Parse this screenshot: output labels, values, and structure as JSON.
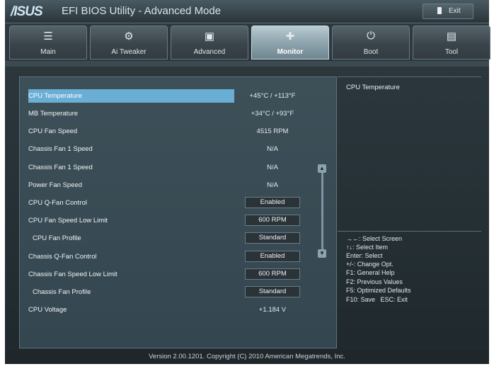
{
  "titlebar": {
    "logo": "/ISUS",
    "title": "EFI BIOS Utility - Advanced Mode",
    "exit_label": "Exit"
  },
  "tabs": [
    {
      "label": "Main",
      "icon": "list-icon"
    },
    {
      "label": "Ai  Tweaker",
      "icon": "tweaker-icon"
    },
    {
      "label": "Advanced",
      "icon": "advanced-icon"
    },
    {
      "label": "Monitor",
      "icon": "monitor-icon",
      "active": true
    },
    {
      "label": "Boot",
      "icon": "power-icon"
    },
    {
      "label": "Tool",
      "icon": "tool-icon"
    }
  ],
  "settings": [
    {
      "label": "CPU Temperature",
      "value": "+45°C / +113°F",
      "type": "text",
      "selected": true
    },
    {
      "label": "MB Temperature",
      "value": "+34°C / +93°F",
      "type": "text"
    },
    {
      "label": "CPU Fan Speed",
      "value": "4515 RPM",
      "type": "text"
    },
    {
      "label": "Chassis Fan 1 Speed",
      "value": "N/A",
      "type": "text"
    },
    {
      "label": "Chassis Fan 1 Speed",
      "value": "N/A",
      "type": "text"
    },
    {
      "label": "Power Fan Speed",
      "value": "N/A",
      "type": "text"
    },
    {
      "label": "CPU Q-Fan Control",
      "value": "Enabled",
      "type": "button"
    },
    {
      "label": "CPU Fan Speed Low Limit",
      "value": "600 RPM",
      "type": "button"
    },
    {
      "label": "CPU Fan Profile",
      "value": "Standard",
      "type": "button",
      "indent": true
    },
    {
      "label": "Chassis Q-Fan Control",
      "value": "Enabled",
      "type": "button"
    },
    {
      "label": "Chassis Fan Speed Low Limit",
      "value": "600 RPM",
      "type": "button"
    },
    {
      "label": "Chassis Fan Profile",
      "value": "Standard",
      "type": "button",
      "indent": true
    },
    {
      "label": "CPU Voltage",
      "value": "+1.184 V",
      "type": "text"
    }
  ],
  "help": {
    "title": "CPU Temperature",
    "lines": [
      "→←: Select Screen",
      "↑↓: Select Item",
      "Enter: Select",
      "+/-: Change Opt.",
      "F1: General Help",
      "F2: Previous Values",
      "F5: Optimized Defaults",
      "F10: Save   ESC: Exit"
    ]
  },
  "footer": "Version  2.00.1201.  Copyright  (C)  2010  American  Megatrends,  Inc."
}
